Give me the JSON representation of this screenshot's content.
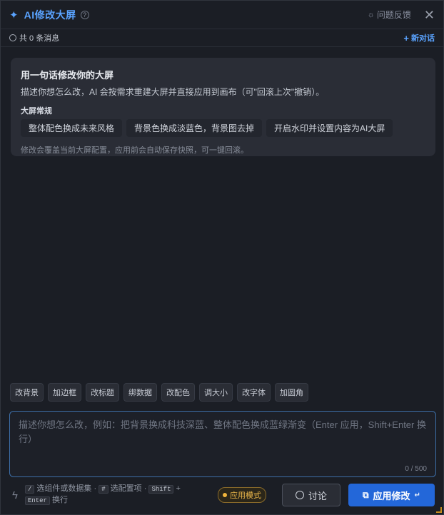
{
  "header": {
    "title": "AI修改大屏",
    "help_symbol": "?",
    "feedback_label": "问题反馈",
    "close_symbol": "✕"
  },
  "subheader": {
    "message_count": "共 0 条消息",
    "new_chat_label": "新对话"
  },
  "welcome": {
    "heading": "用一句话修改你的大屏",
    "description": "描述你想怎么改，AI 会按需求重建大屏并直接应用到画布（可\"回滚上次\"撤销）。",
    "section_label": "大屏常规",
    "suggestions": [
      "整体配色换成未来风格",
      "背景色换成淡蓝色，背景图去掉",
      "开启水印并设置内容为AI大屏"
    ],
    "note": "修改会覆盖当前大屏配置，应用前会自动保存快照，可一键回滚。"
  },
  "quick_actions": [
    "改背景",
    "加边框",
    "改标题",
    "绑数据",
    "改配色",
    "调大小",
    "改字体",
    "加圆角"
  ],
  "input": {
    "placeholder": "描述你想怎么改，例如：把背景换成科技深蓝、整体配色换成蓝绿渐变（Enter 应用，Shift+Enter 换行）",
    "value": "",
    "counter": "0 / 500"
  },
  "footer": {
    "hint_key_1": "/",
    "hint_text_1": "选组件或数据集 ·",
    "hint_key_2": "#",
    "hint_text_2": "选配置项 ·",
    "hint_key_3": "Shift",
    "hint_plus": "+",
    "hint_key_4": "Enter",
    "hint_text_3": "换行",
    "mode_label": "应用模式",
    "discuss_label": "讨论",
    "apply_label": "应用修改",
    "apply_enter_symbol": "↵"
  },
  "colors": {
    "accent": "#5aa3ff",
    "primary_button": "#2367d9",
    "mode_badge": "#f0b43c",
    "panel_bg": "#1b1e25"
  },
  "icons": {
    "title": "sparkle-icon",
    "help": "help-circle-icon",
    "feedback": "bug-icon",
    "close": "close-icon",
    "messages": "chat-bubble-icon",
    "new_chat": "plus-icon",
    "footer_left": "lightning-icon",
    "discuss": "chat-bubble-icon",
    "apply": "apply-icon"
  }
}
